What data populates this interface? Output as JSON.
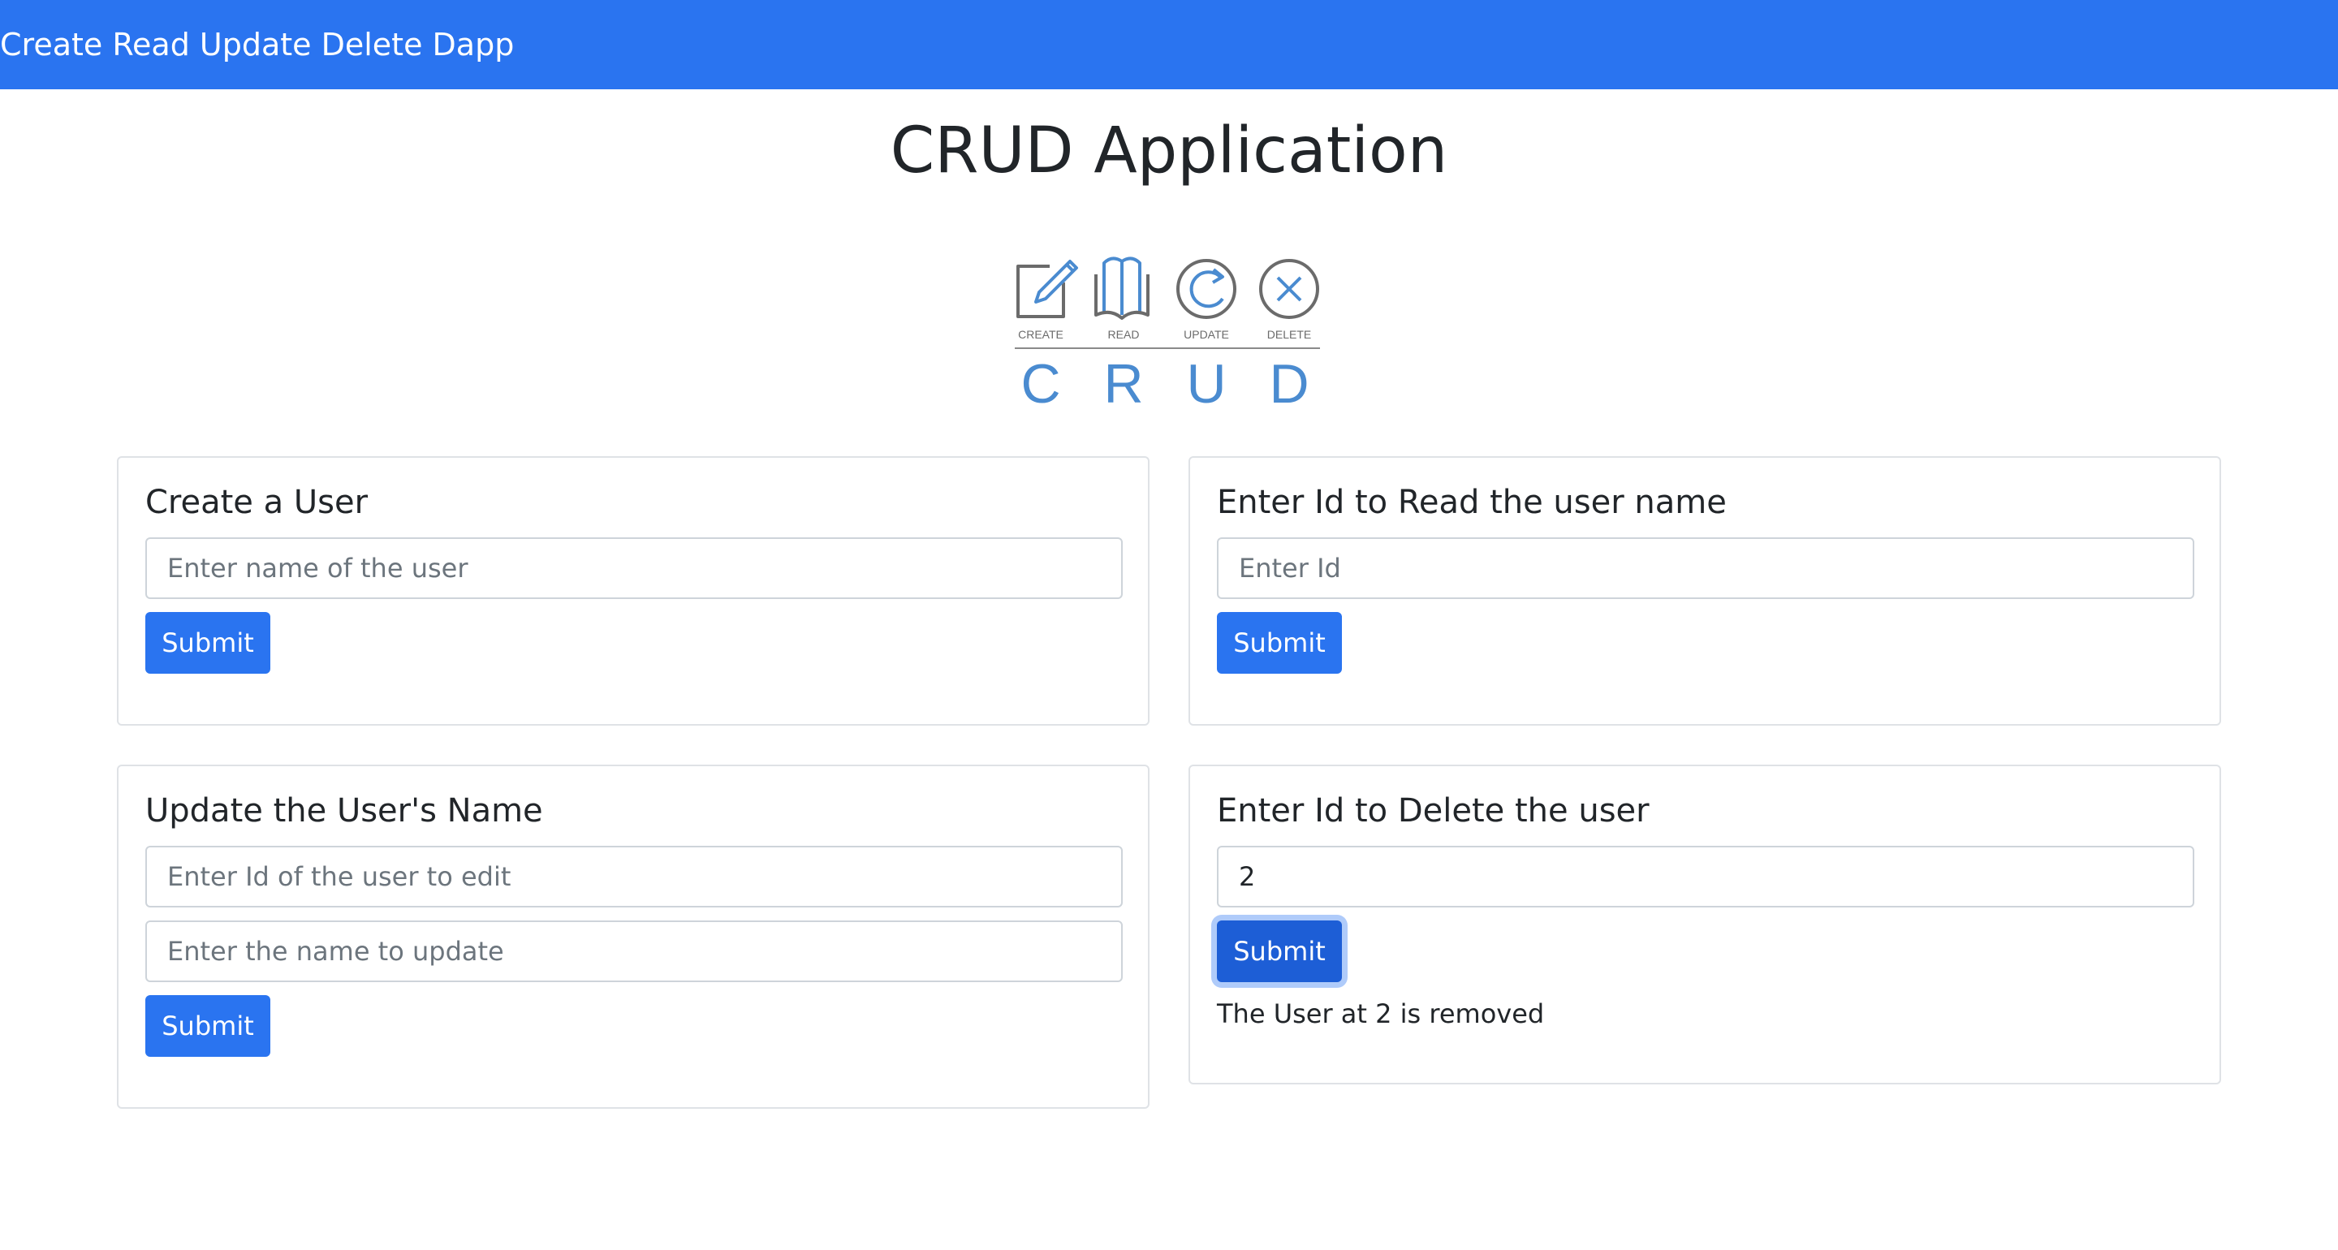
{
  "navbar": {
    "brand": "Create Read Update Delete Dapp"
  },
  "page": {
    "title": "CRUD Application"
  },
  "logo": {
    "icon_labels": [
      "CREATE",
      "READ",
      "UPDATE",
      "DELETE"
    ],
    "letters": [
      "C",
      "R",
      "U",
      "D"
    ]
  },
  "colors": {
    "primary": "#2a74f0",
    "logo_blue": "#4a8bd0",
    "logo_gray": "#6b6b6b"
  },
  "create_card": {
    "title": "Create a User",
    "name_placeholder": "Enter name of the user",
    "submit_label": "Submit"
  },
  "read_card": {
    "title": "Enter Id to Read the user name",
    "id_placeholder": "Enter Id",
    "submit_label": "Submit"
  },
  "update_card": {
    "title": "Update the User's Name",
    "id_placeholder": "Enter Id of the user to edit",
    "name_placeholder": "Enter the name to update",
    "submit_label": "Submit"
  },
  "delete_card": {
    "title": "Enter Id to Delete the user",
    "id_value": "2",
    "submit_label": "Submit",
    "result": "The User at 2 is removed"
  }
}
